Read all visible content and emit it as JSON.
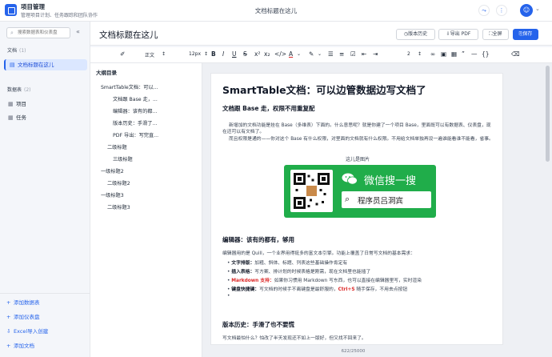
{
  "app": {
    "title": "项目管理",
    "subtitle": "管理项目计划、任务跟踪和团队协作",
    "doc_title": "文档标题在这儿",
    "avatar_icon": "user-icon"
  },
  "sidebar": {
    "search_placeholder": "搜索数据表和仪表盘",
    "docs_label": "文档",
    "docs_count": "(1)",
    "docs": [
      {
        "label": "文档标题在这儿"
      }
    ],
    "tables_label": "数据表",
    "tables_count": "(2)",
    "tables": [
      {
        "label": "项目"
      },
      {
        "label": "任务"
      }
    ],
    "actions": [
      {
        "label": "添加数据表"
      },
      {
        "label": "添加仪表盘"
      },
      {
        "label": "Excel导入创建"
      },
      {
        "label": "添加文档"
      }
    ]
  },
  "header": {
    "title": "文档标题在这儿",
    "history": "版本历史",
    "export": "导出 PDF",
    "fullscreen": "全屏",
    "save": "保存"
  },
  "toolbar": {
    "paragraph": "正文",
    "font_size": "12px",
    "list_num": "2"
  },
  "toc": {
    "title": "大纲目录",
    "items": [
      "SmartTable文档：可以...",
      "文档跟 Base 走，...",
      "编辑器：该有的都...",
      "版本历史：手滑了...",
      "PDF 导出：写完直...",
      "二级标题",
      "三级标题",
      "一级标题2",
      "二级标题2",
      "一级标题3",
      "二级标题3"
    ]
  },
  "doc": {
    "h1": "SmartTable文档：可以边管数据边写文档了",
    "s1_title": "文档跟 Base 走，权限不用重复配",
    "s1_p1": "新增加的文档功能是挂在 Base（多维表）下面的。什么意思呢？就是你建了一个项目 Base，里面既可以有数据表、仪表盘，现在还可以有文档了。",
    "s1_p2": "而且权限是通的——你对这个 Base 有什么权限，对里面的文档就有什么权限。不用给文档单独再设一遍谁能看谁不能看，省事。",
    "img_caption": "这儿是图片",
    "wechat_text": "微信搜一搜",
    "wechat_search": "程序员吕洞宾",
    "s2_title": "编辑器：该有的都有，够用",
    "s2_p": "编辑器用的是 Quill，一个业界用得挺多的富文本引擎。功能上覆盖了日常写文档的基本需求：",
    "b1_key": "文字排版：",
    "b1_val": "加粗、斜体、标题、列表这些基础操作肯定有",
    "b2_key": "插入表格：",
    "b2_val": "写方案、排计划的时候表格是刚需，现在文档里也能插了",
    "b3_key": "Markdown 支持：",
    "b3_val": "如果你习惯用 Markdown 写东西，也可以直接在编辑器里写，实时渲染",
    "b4_key": "键盘快捷键：",
    "b4_val1": "写文档的时候手不离键盘是最舒服的，",
    "b4_key2": "Ctrl+S",
    "b4_val2": " 随手保存，不用去点按钮",
    "s3_title": "版本历史：手滑了也不要慌",
    "s3_p": "写文档最怕什么？怕改了半天发现还不如上一版好，但又找不回来了。"
  },
  "status": {
    "count": "622/25000"
  }
}
